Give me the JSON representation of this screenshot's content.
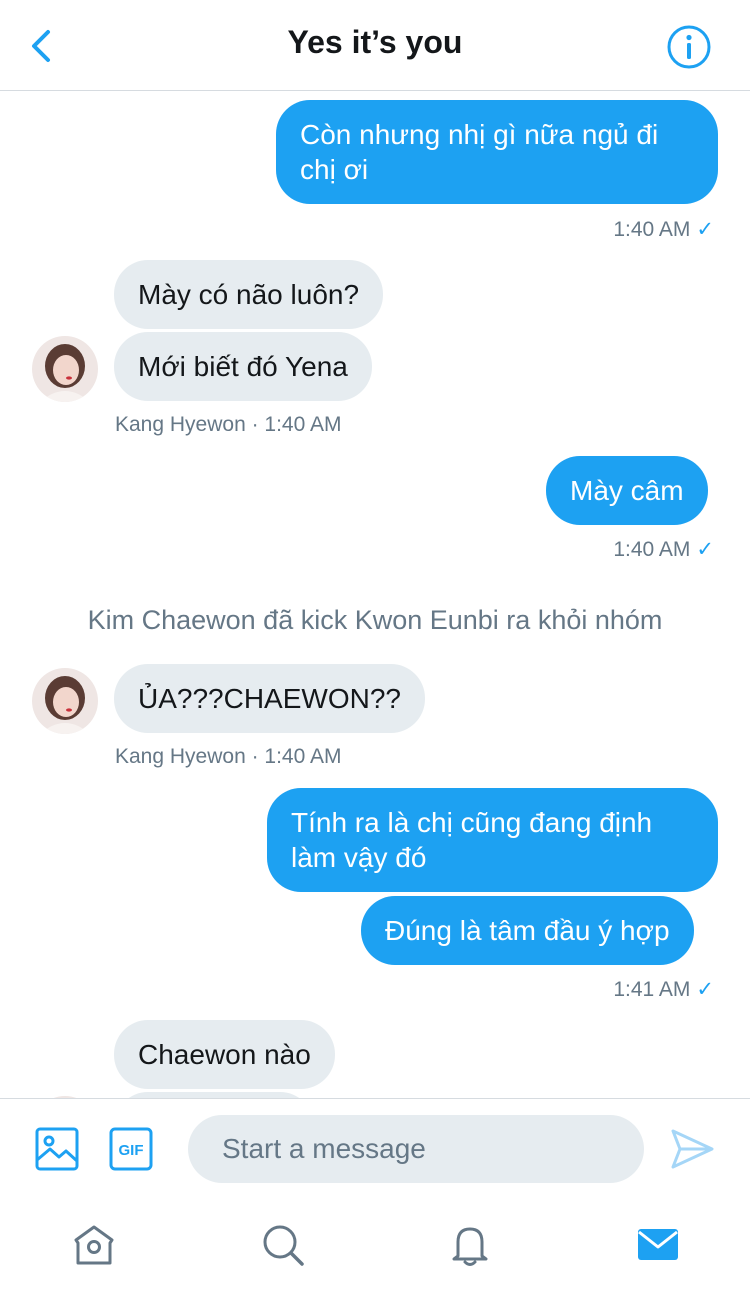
{
  "header": {
    "title": "Yes it’s you",
    "back_icon": "chevron-left-icon",
    "info_icon": "info-icon"
  },
  "messages": {
    "m1": {
      "text": "Còn nhưng nhị gì nữa ngủ đi chị ơi",
      "time": "1:40 AM ✓"
    },
    "m2": {
      "text": "Mày có não luôn?"
    },
    "m3": {
      "text": "Mới biết đó Yena",
      "meta": "Kang Hyewon · 1:40 AM"
    },
    "m4": {
      "text": "Mày câm",
      "time": "1:40 AM ✓"
    },
    "system1": "Kim Chaewon đã kick Kwon Eunbi ra khỏi nhóm",
    "m5": {
      "text": "ỦA???CHAEWON??",
      "meta": "Kang Hyewon · 1:40 AM"
    },
    "m6": {
      "text": "Tính ra là chị cũng đang định làm vậy đó"
    },
    "m7": {
      "text": "Đúng là tâm đầu ý hợp",
      "time": "1:41 AM ✓"
    },
    "m8": {
      "text": "Chaewon nào"
    }
  },
  "composer": {
    "placeholder": "Start a message",
    "gif_label": "GIF"
  },
  "tabs": [
    "home-icon",
    "search-icon",
    "bell-icon",
    "mail-icon"
  ],
  "colors": {
    "accent": "#1da1f2",
    "incoming_bubble": "#e6ecf0",
    "meta_text": "#657786"
  }
}
